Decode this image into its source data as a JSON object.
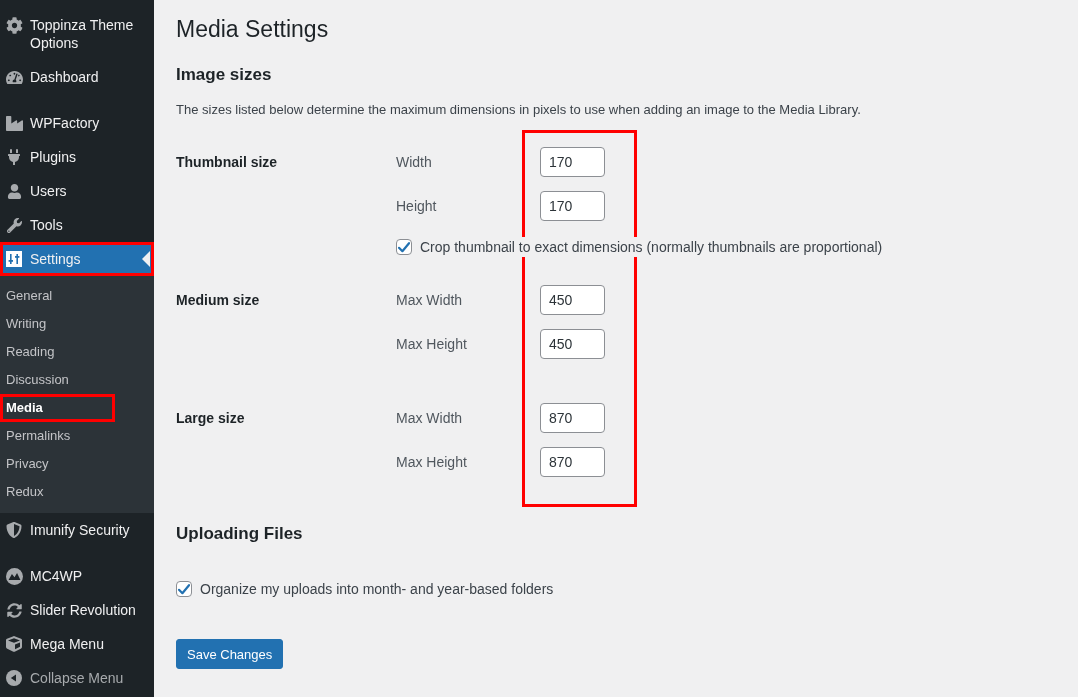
{
  "sidebar": {
    "groups": [
      {
        "items": [
          {
            "label": "Toppinza Theme Options",
            "selected": false,
            "highlighted": false
          },
          {
            "label": "Dashboard",
            "selected": false,
            "highlighted": false
          }
        ]
      },
      {
        "items": [
          {
            "label": "WPFactory",
            "selected": false,
            "highlighted": false
          },
          {
            "label": "Plugins",
            "selected": false,
            "highlighted": false
          },
          {
            "label": "Users",
            "selected": false,
            "highlighted": false
          },
          {
            "label": "Tools",
            "selected": false,
            "highlighted": false
          },
          {
            "label": "Settings",
            "selected": true,
            "highlighted": true,
            "submenu": [
              {
                "label": "General",
                "selected": false,
                "highlighted": false
              },
              {
                "label": "Writing",
                "selected": false,
                "highlighted": false
              },
              {
                "label": "Reading",
                "selected": false,
                "highlighted": false
              },
              {
                "label": "Discussion",
                "selected": false,
                "highlighted": false
              },
              {
                "label": "Media",
                "selected": true,
                "highlighted": true
              },
              {
                "label": "Permalinks",
                "selected": false,
                "highlighted": false
              },
              {
                "label": "Privacy",
                "selected": false,
                "highlighted": false
              },
              {
                "label": "Redux",
                "selected": false,
                "highlighted": false
              }
            ]
          },
          {
            "label": "Imunify Security",
            "selected": false,
            "highlighted": false
          }
        ]
      },
      {
        "items": [
          {
            "label": "MC4WP",
            "selected": false,
            "highlighted": false
          },
          {
            "label": "Slider Revolution",
            "selected": false,
            "highlighted": false
          },
          {
            "label": "Mega Menu",
            "selected": false,
            "highlighted": false
          }
        ]
      }
    ],
    "collapse_button": {
      "label": "Collapse Menu"
    }
  },
  "page": {
    "title": "Media Settings",
    "image_sizes": {
      "heading": "Image sizes",
      "description": "The sizes listed below determine the maximum dimensions in pixels to use when adding an image to the Media Library.",
      "fields_highlighted": true,
      "groups": [
        {
          "label": "Thumbnail size",
          "fields": [
            {
              "label": "Width",
              "value": "170"
            },
            {
              "label": "Height",
              "value": "170"
            }
          ],
          "option": {
            "label": "Crop thumbnail to exact dimensions (normally thumbnails are proportional)",
            "checked": true
          }
        },
        {
          "label": "Medium size",
          "fields": [
            {
              "label": "Max Width",
              "value": "450"
            },
            {
              "label": "Max Height",
              "value": "450"
            }
          ]
        },
        {
          "label": "Large size",
          "fields": [
            {
              "label": "Max Width",
              "value": "870"
            },
            {
              "label": "Max Height",
              "value": "870"
            }
          ]
        }
      ]
    },
    "uploading_files": {
      "heading": "Uploading Files",
      "option": {
        "label": "Organize my uploads into month- and year-based folders",
        "checked": true
      }
    },
    "save_button": {
      "label": "Save Changes"
    }
  }
}
